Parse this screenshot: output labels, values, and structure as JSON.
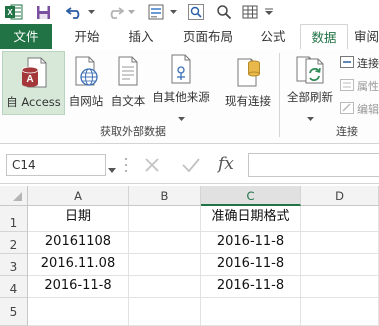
{
  "quick_access": {
    "app_icon": "excel-logo-icon",
    "icons": [
      "save-icon",
      "undo-icon",
      "redo-icon",
      "form-icon",
      "search-icon",
      "table-icon"
    ]
  },
  "tabs": [
    {
      "label": "文件",
      "kind": "file"
    },
    {
      "label": "开始"
    },
    {
      "label": "插入"
    },
    {
      "label": "页面布局"
    },
    {
      "label": "公式"
    },
    {
      "label": "数据",
      "kind": "active"
    },
    {
      "label": "审阅"
    }
  ],
  "ribbon": {
    "get_external": {
      "group_label": "获取外部数据",
      "buttons": [
        "自 Access",
        "自网站",
        "自文本",
        "自其他来源",
        "现有连接"
      ]
    },
    "connections": {
      "group_label": "连接",
      "refresh_label": "全部刷新",
      "small_items": [
        "连接",
        "属性",
        "编辑"
      ]
    }
  },
  "formula_bar": {
    "name_box": "C14",
    "fx_label": "fx",
    "formula": ""
  },
  "sheet": {
    "columns": [
      "A",
      "B",
      "C",
      "D"
    ],
    "selected_column": "C",
    "rows": [
      {
        "num": "1",
        "A": "日期",
        "B": "",
        "C": "准确日期格式",
        "D": ""
      },
      {
        "num": "2",
        "A": "20161108",
        "B": "",
        "C": "2016-11-8",
        "D": ""
      },
      {
        "num": "3",
        "A": "2016.11.08",
        "B": "",
        "C": "2016-11-8",
        "D": ""
      },
      {
        "num": "4",
        "A": "2016-11-8",
        "B": "",
        "C": "2016-11-8",
        "D": ""
      },
      {
        "num": "5",
        "A": "",
        "B": "",
        "C": "",
        "D": ""
      }
    ]
  },
  "colors": {
    "accent": "#217346",
    "selected_button_bg": "#d7e8d9"
  }
}
